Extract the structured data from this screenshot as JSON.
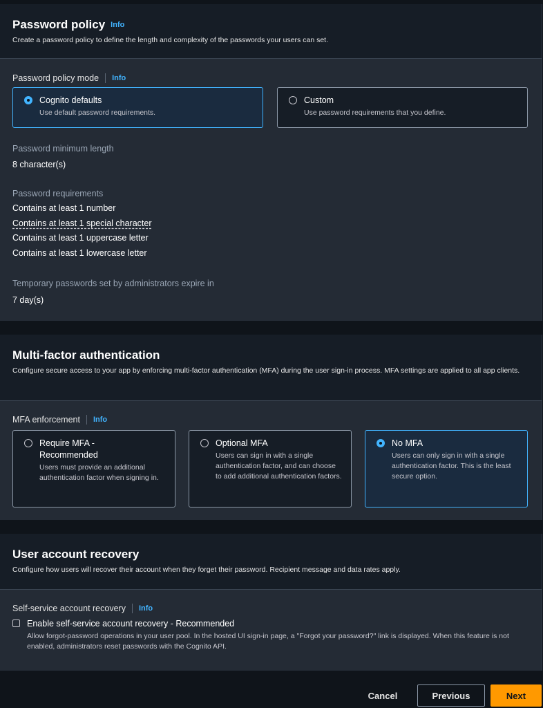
{
  "password_policy": {
    "title": "Password policy",
    "info": "Info",
    "description": "Create a password policy to define the length and complexity of the passwords your users can set.",
    "mode_label": "Password policy mode",
    "mode_info": "Info",
    "options": [
      {
        "title": "Cognito defaults",
        "desc": "Use default password requirements.",
        "selected": true
      },
      {
        "title": "Custom",
        "desc": "Use password requirements that you define.",
        "selected": false
      }
    ],
    "min_length_label": "Password minimum length",
    "min_length_value": "8 character(s)",
    "requirements_label": "Password requirements",
    "requirements": [
      "Contains at least 1 number",
      "Contains at least 1 special character",
      "Contains at least 1 uppercase letter",
      "Contains at least 1 lowercase letter"
    ],
    "temp_label": "Temporary passwords set by administrators expire in",
    "temp_value": "7 day(s)"
  },
  "mfa": {
    "title": "Multi-factor authentication",
    "description": "Configure secure access to your app by enforcing multi-factor authentication (MFA) during the user sign-in process. MFA settings are applied to all app clients.",
    "enforcement_label": "MFA enforcement",
    "enforcement_info": "Info",
    "options": [
      {
        "title": "Require MFA - Recommended",
        "desc": "Users must provide an additional authentication factor when signing in.",
        "selected": false
      },
      {
        "title": "Optional MFA",
        "desc": "Users can sign in with a single authentication factor, and can choose to add additional authentication factors.",
        "selected": false
      },
      {
        "title": "No MFA",
        "desc": "Users can only sign in with a single authentication factor. This is the least secure option.",
        "selected": true
      }
    ]
  },
  "recovery": {
    "title": "User account recovery",
    "description": "Configure how users will recover their account when they forget their password. Recipient message and data rates apply.",
    "self_service_label": "Self-service account recovery",
    "self_service_info": "Info",
    "checkbox_label": "Enable self-service account recovery - Recommended",
    "checkbox_checked": false,
    "checkbox_desc": "Allow forgot-password operations in your user pool. In the hosted UI sign-in page, a \"Forgot your password?\" link is displayed. When this feature is not enabled, administrators reset passwords with the Cognito API."
  },
  "footer": {
    "cancel": "Cancel",
    "previous": "Previous",
    "next": "Next"
  }
}
